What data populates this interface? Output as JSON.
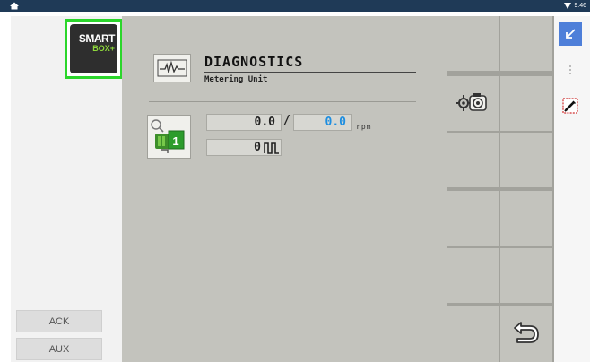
{
  "statusbar": {
    "time": "9:46"
  },
  "logo": {
    "line1": "SMART",
    "line2": "BOX+"
  },
  "side_buttons": {
    "ack": "ACK",
    "aux": "AUX"
  },
  "diagnostics": {
    "title": "DIAGNOSTICS",
    "subtitle": "Metering Unit",
    "unit_number": "1",
    "actual_rpm": "0.0",
    "separator": "/",
    "target_rpm": "0.0",
    "rpm_unit": "rpm",
    "pulses": "0"
  },
  "colors": {
    "accent_green": "#2bd62b",
    "value_blue": "#1e8ee0",
    "status_bar": "#1f3a57",
    "blue_button": "#4e7fd9"
  },
  "icons": [
    "pulse-wave-icon",
    "metering-unit-icon",
    "camera-settings-icon",
    "back-arrow-icon",
    "minimize-arrow-icon",
    "more-options-icon",
    "edit-crossed-icon",
    "signal-icon",
    "pulse-signal-icon"
  ]
}
